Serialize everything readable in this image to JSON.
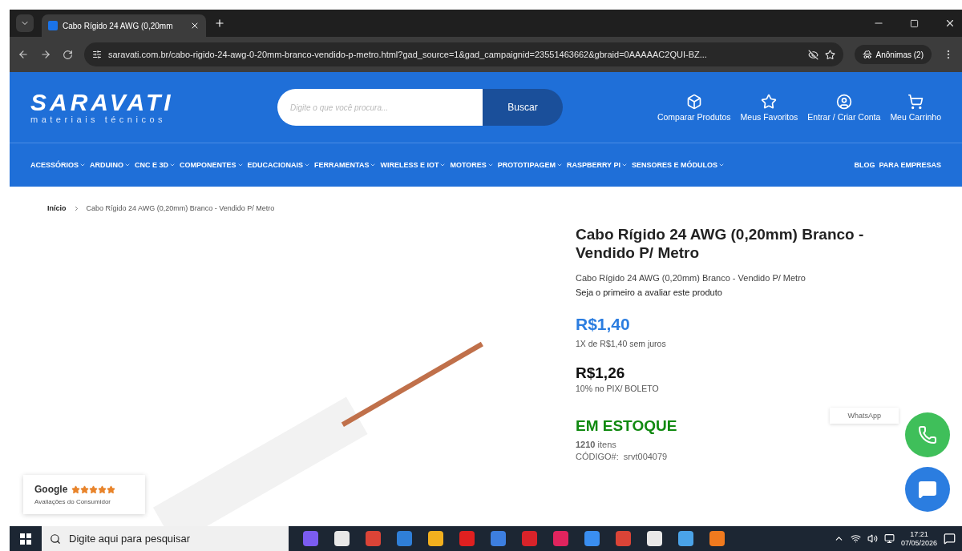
{
  "browser": {
    "tab_title": "Cabo Rígido 24 AWG (0,20mm",
    "url": "saravati.com.br/cabo-rigido-24-awg-0-20mm-branco-vendido-p-metro.html?gad_source=1&gad_campaignid=23551463662&gbraid=0AAAAAC2QUI-BZ...",
    "profile": "Anônimas (2)"
  },
  "header": {
    "logo": "SARAVATI",
    "tagline": "materiais técnicos",
    "search": {
      "placeholder": "Digite o que você procura..."
    },
    "search_button": "Buscar",
    "actions": [
      {
        "kind": "compare",
        "label": "Comparar Produtos"
      },
      {
        "kind": "favorites",
        "label": "Meus Favoritos"
      },
      {
        "kind": "account",
        "label": "Entrar / Criar Conta"
      },
      {
        "kind": "cart",
        "label": "Meu Carrinho"
      }
    ]
  },
  "nav": {
    "items": [
      {
        "label": "ACESSÓRIOS",
        "dropdown": true
      },
      {
        "label": "ARDUINO",
        "dropdown": true
      },
      {
        "label": "CNC E 3D",
        "dropdown": true
      },
      {
        "label": "COMPONENTES",
        "dropdown": true
      },
      {
        "label": "EDUCACIONAIS",
        "dropdown": true
      },
      {
        "label": "FERRAMENTAS",
        "dropdown": true
      },
      {
        "label": "WIRELESS E IOT",
        "dropdown": true
      },
      {
        "label": "MOTORES",
        "dropdown": true
      },
      {
        "label": "PROTOTIPAGEM",
        "dropdown": true
      },
      {
        "label": "RASPBERRY PI",
        "dropdown": true
      },
      {
        "label": "SENSORES E MÓDULOS",
        "dropdown": true
      }
    ],
    "right_links": [
      "BLOG",
      "PARA EMPRESAS"
    ]
  },
  "breadcrumb": [
    "Início",
    "Cabo Rígido 24 AWG (0,20mm) Branco - Vendido P/ Metro"
  ],
  "product": {
    "title": "Cabo Rígido 24 AWG (0,20mm) Branco - Vendido P/ Metro",
    "subtitle": "Cabo Rígido 24 AWG (0,20mm) Branco - Vendido P/ Metro",
    "review_prompt": "Seja o primeiro a avaliar este produto",
    "price": "R$1,40",
    "installments": "1X de R$1,40 sem juros",
    "pix_price": "R$1,26",
    "pix_note": "10% no PIX/ BOLETO",
    "stock": "EM ESTOQUE",
    "stock_count": "**1210** itens",
    "code_label": "CÓDIGO#:",
    "code": "srvt004079"
  },
  "google_badge": {
    "name": "Google",
    "stars": 5,
    "caption": "Avaliações do Consumidor"
  },
  "whatsapp": {
    "label": "WhatsApp"
  },
  "taskbar": {
    "search": {
      "placeholder": "Digite aqui para pesquisar"
    },
    "time": "17:21",
    "date": "07/05/2026"
  }
}
